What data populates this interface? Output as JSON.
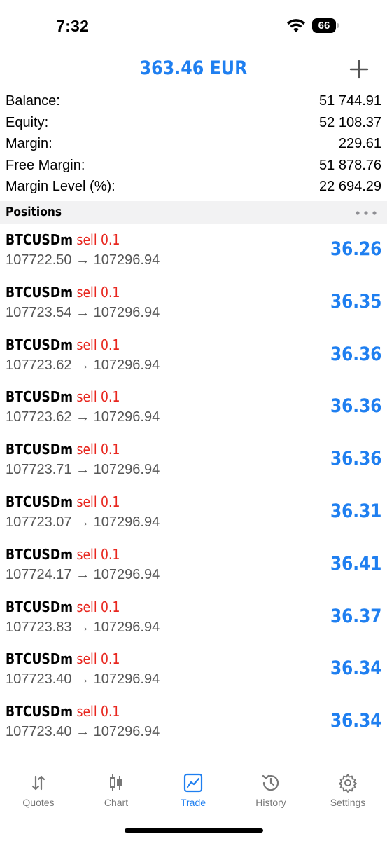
{
  "status_bar": {
    "time": "7:32",
    "battery_level": "66",
    "battery_fraction": 0.66
  },
  "header": {
    "title": "363.46 EUR",
    "add_icon": "plus-icon"
  },
  "summary": [
    {
      "label": "Balance:",
      "value": "51 744.91"
    },
    {
      "label": "Equity:",
      "value": "52 108.37"
    },
    {
      "label": "Margin:",
      "value": "229.61"
    },
    {
      "label": "Free Margin:",
      "value": "51 878.76"
    },
    {
      "label": "Margin Level (%):",
      "value": "22 694.29"
    }
  ],
  "positions_section": {
    "title": "Positions",
    "menu_icon": "more-horizontal-icon"
  },
  "positions": [
    {
      "symbol": "BTCUSDm",
      "side": "sell 0.1",
      "prices": "107722.50 → 107296.94",
      "profit": "36.26"
    },
    {
      "symbol": "BTCUSDm",
      "side": "sell 0.1",
      "prices": "107723.54 → 107296.94",
      "profit": "36.35"
    },
    {
      "symbol": "BTCUSDm",
      "side": "sell 0.1",
      "prices": "107723.62 → 107296.94",
      "profit": "36.36"
    },
    {
      "symbol": "BTCUSDm",
      "side": "sell 0.1",
      "prices": "107723.62 → 107296.94",
      "profit": "36.36"
    },
    {
      "symbol": "BTCUSDm",
      "side": "sell 0.1",
      "prices": "107723.71 → 107296.94",
      "profit": "36.36"
    },
    {
      "symbol": "BTCUSDm",
      "side": "sell 0.1",
      "prices": "107723.07 → 107296.94",
      "profit": "36.31"
    },
    {
      "symbol": "BTCUSDm",
      "side": "sell 0.1",
      "prices": "107724.17 → 107296.94",
      "profit": "36.41"
    },
    {
      "symbol": "BTCUSDm",
      "side": "sell 0.1",
      "prices": "107723.83 → 107296.94",
      "profit": "36.37"
    },
    {
      "symbol": "BTCUSDm",
      "side": "sell 0.1",
      "prices": "107723.40 → 107296.94",
      "profit": "36.34"
    },
    {
      "symbol": "BTCUSDm",
      "side": "sell 0.1",
      "prices": "107723.40 → 107296.94",
      "profit": "36.34"
    }
  ],
  "tabs": [
    {
      "label": "Quotes",
      "icon": "quotes-arrows-icon",
      "active": false
    },
    {
      "label": "Chart",
      "icon": "candlestick-chart-icon",
      "active": false
    },
    {
      "label": "Trade",
      "icon": "trade-chart-icon",
      "active": true
    },
    {
      "label": "History",
      "icon": "history-clock-icon",
      "active": false
    },
    {
      "label": "Settings",
      "icon": "gear-icon",
      "active": false
    }
  ],
  "colors": {
    "accent": "#1f7ff0",
    "sell": "#e8271f",
    "section_bg": "#f2f2f3",
    "muted": "#555555"
  }
}
